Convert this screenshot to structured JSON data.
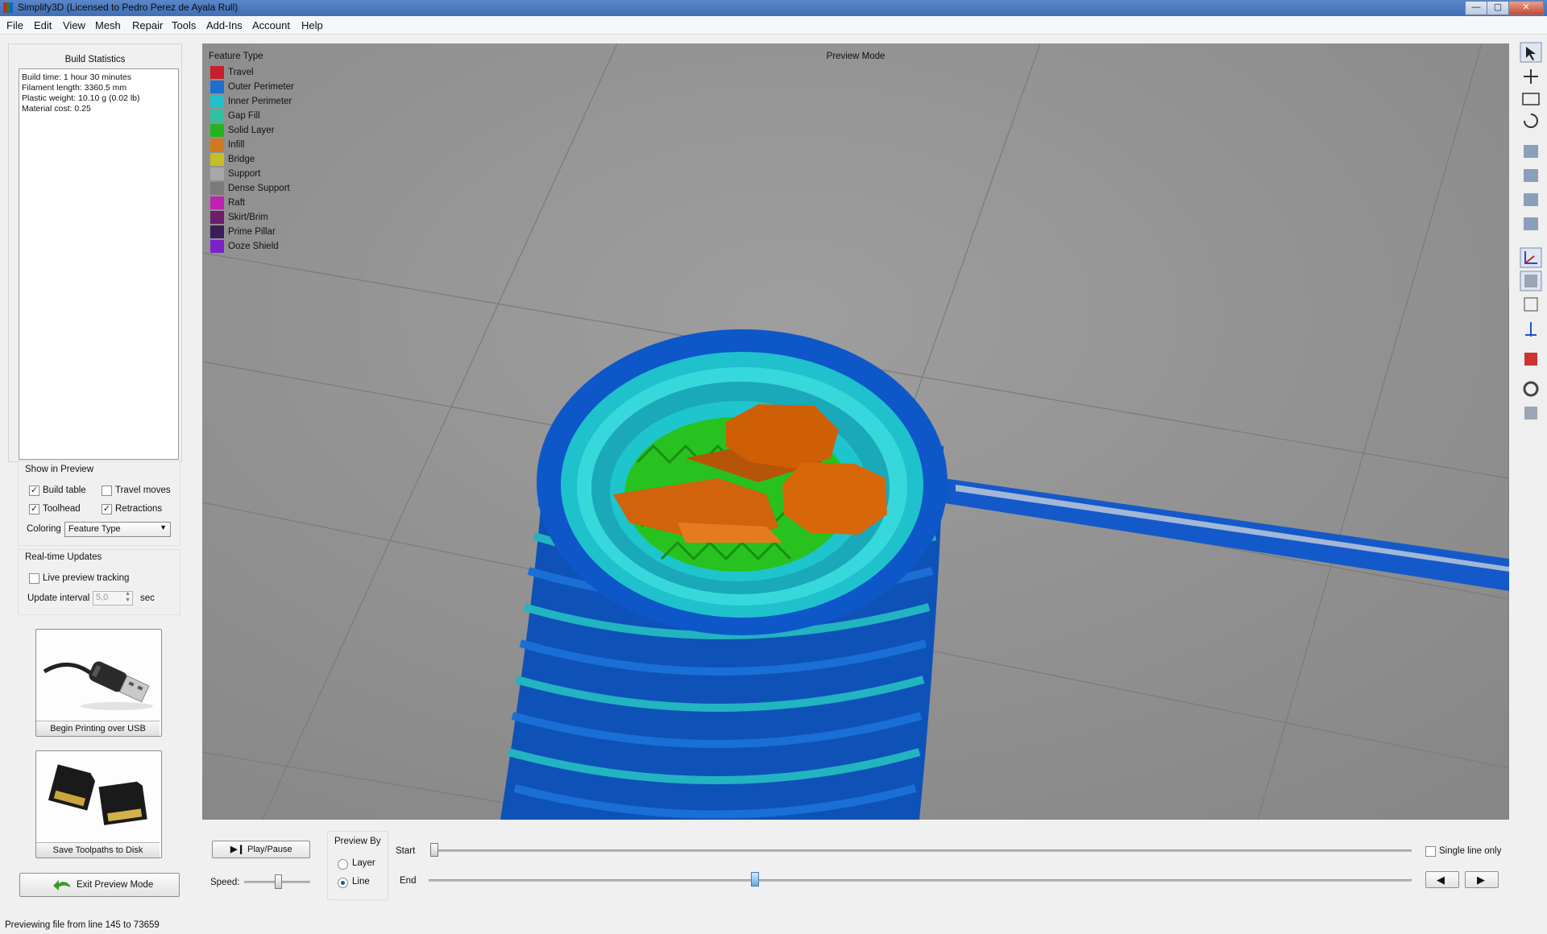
{
  "window": {
    "title": "Simplify3D (Licensed to Pedro Perez de Ayala Rull)",
    "minimize": "—",
    "maximize": "▢",
    "close": "✕"
  },
  "menu": [
    "File",
    "Edit",
    "View",
    "Mesh",
    "Repair",
    "Tools",
    "Add-Ins",
    "Account",
    "Help"
  ],
  "build_stats": {
    "title": "Build Statistics",
    "lines": [
      "Build time: 1 hour 30 minutes",
      "Filament length: 3360.5 mm",
      "Plastic weight: 10.10 g (0.02 lb)",
      "Material cost: 0.25"
    ]
  },
  "show_in_preview": {
    "title": "Show in Preview",
    "build_table": {
      "label": "Build table",
      "checked": true
    },
    "travel_moves": {
      "label": "Travel moves",
      "checked": false
    },
    "toolhead": {
      "label": "Toolhead",
      "checked": true
    },
    "retractions": {
      "label": "Retractions",
      "checked": true
    },
    "coloring_label": "Coloring",
    "coloring_value": "Feature Type"
  },
  "realtime": {
    "title": "Real-time Updates",
    "live_tracking": {
      "label": "Live preview tracking",
      "checked": false
    },
    "interval_label": "Update interval",
    "interval_value": "5,0",
    "interval_unit": "sec"
  },
  "usb_button": {
    "label": "Begin Printing over USB"
  },
  "disk_button": {
    "label": "Save Toolpaths to Disk"
  },
  "exit_button": {
    "label": "Exit Preview Mode"
  },
  "viewport": {
    "mode_label": "Preview Mode",
    "legend_title": "Feature Type",
    "legend": [
      {
        "label": "Travel",
        "color": "#c8202a"
      },
      {
        "label": "Outer Perimeter",
        "color": "#1f6fd1"
      },
      {
        "label": "Inner Perimeter",
        "color": "#22c0c8"
      },
      {
        "label": "Gap Fill",
        "color": "#2fc2a0"
      },
      {
        "label": "Solid Layer",
        "color": "#23b520"
      },
      {
        "label": "Infill",
        "color": "#d2781e"
      },
      {
        "label": "Bridge",
        "color": "#c4bf22"
      },
      {
        "label": "Support",
        "color": "#a8a8a8"
      },
      {
        "label": "Dense Support",
        "color": "#7a7a7a"
      },
      {
        "label": "Raft",
        "color": "#c021b3"
      },
      {
        "label": "Skirt/Brim",
        "color": "#6b1c6b"
      },
      {
        "label": "Prime Pillar",
        "color": "#3c1d5c"
      },
      {
        "label": "Ooze Shield",
        "color": "#7a22c8"
      }
    ]
  },
  "toolbar_icons": [
    "select-icon",
    "move-icon",
    "scale-icon",
    "rotate-icon",
    "view-iso-icon",
    "view-front-icon",
    "view-side-icon",
    "view-top-icon",
    "axes-icon",
    "solid-view-icon",
    "wireframe-icon",
    "z-axis-icon",
    "cross-section-icon",
    "settings-gear-icon",
    "supports-icon"
  ],
  "playback": {
    "play_label": "Play/Pause",
    "speed_label": "Speed:",
    "speed_value": 0.5,
    "preview_by_title": "Preview By",
    "layer_label": "Layer",
    "line_label": "Line",
    "selected": "Line",
    "start_label": "Start",
    "end_label": "End",
    "start_value": 0.0,
    "end_value": 0.33,
    "single_line_label": "Single line only",
    "prev": "◀",
    "next": "▶"
  },
  "status": "Previewing file from line 145 to 73659"
}
